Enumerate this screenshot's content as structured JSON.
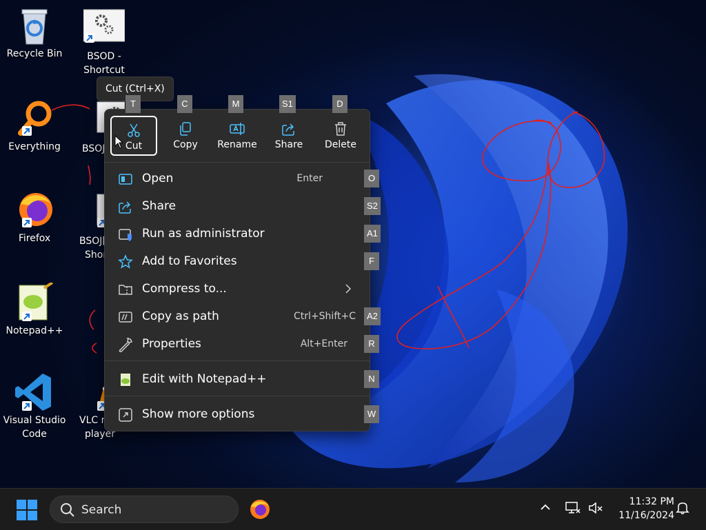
{
  "desktop": {
    "icons": [
      {
        "label": "Recycle Bin"
      },
      {
        "label": "BSOD - Shortcut"
      },
      {
        "label": "Everything"
      },
      {
        "label": "BSOJ"
      },
      {
        "label": "Firefox"
      },
      {
        "label": "BSOJ[",
        "label2": "Shor"
      },
      {
        "label": "Notepad++"
      },
      {
        "label": "Visual Studio Code"
      },
      {
        "label": "VLC m",
        "label2": "player"
      }
    ]
  },
  "tooltip": "Cut (Ctrl+X)",
  "context_menu": {
    "quick_actions": [
      {
        "label": "Cut",
        "key": "T",
        "icon": "scissors-icon",
        "selected": true
      },
      {
        "label": "Copy",
        "key": "C",
        "icon": "copy-icon"
      },
      {
        "label": "Rename",
        "key": "M",
        "icon": "rename-icon"
      },
      {
        "label": "Share",
        "key": "S1",
        "icon": "share-icon"
      },
      {
        "label": "Delete",
        "key": "D",
        "icon": "trash-icon"
      }
    ],
    "items": [
      {
        "label": "Open",
        "shortcut": "Enter",
        "key": "O",
        "icon": "open-icon"
      },
      {
        "label": "Share",
        "shortcut": "",
        "key": "S2",
        "icon": "share-icon"
      },
      {
        "label": "Run as administrator",
        "shortcut": "",
        "key": "A1",
        "icon": "shield-icon"
      },
      {
        "label": "Add to Favorites",
        "shortcut": "",
        "key": "F",
        "icon": "star-icon"
      },
      {
        "label": "Compress to...",
        "shortcut": "",
        "key": "",
        "icon": "zip-folder-icon"
      },
      {
        "label": "Copy as path",
        "shortcut": "Ctrl+Shift+C",
        "key": "A2",
        "icon": "path-icon"
      },
      {
        "label": "Properties",
        "shortcut": "Alt+Enter",
        "key": "R",
        "icon": "wrench-icon"
      },
      {
        "label": "Edit with Notepad++",
        "shortcut": "",
        "key": "N",
        "icon": "notepad-icon"
      },
      {
        "label": "Show more options",
        "shortcut": "",
        "key": "W",
        "icon": "more-options-icon"
      }
    ]
  },
  "taskbar": {
    "search_placeholder": "Search",
    "time": "11:32 PM",
    "date": "11/16/2024"
  },
  "colors": {
    "menu_bg": "#2c2c2c",
    "taskbar_bg": "#1c1c1c",
    "badge_bg": "#6e6e6e",
    "annotation_red": "#e02020",
    "accent_blue": "#4cc2ff"
  }
}
